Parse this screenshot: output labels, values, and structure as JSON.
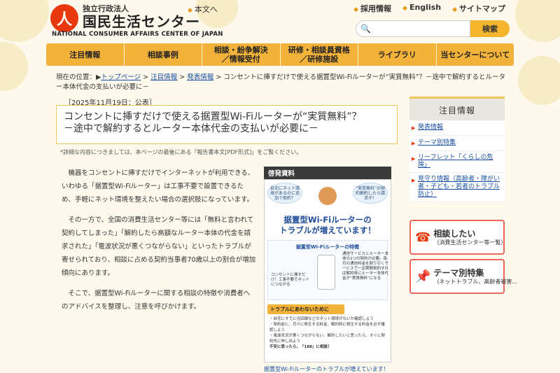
{
  "header": {
    "logo_mark": "人",
    "logo_sub": "独立行政法人",
    "logo_main": "国民生活センター",
    "logo_en": "NATIONAL CONSUMER AFFAIRS CENTER OF JAPAN",
    "body_link": "本文へ",
    "top_links": [
      "採用情報",
      "English",
      "サイトマップ"
    ],
    "search_placeholder": "",
    "search_button": "検索"
  },
  "nav": [
    "注目情報",
    "相談事例",
    "相談・紛争解決\n／情報受付",
    "研修・相談員資格\n／研修施設",
    "ライブラリ",
    "当センターについて"
  ],
  "breadcrumb": {
    "prefix": "現在の位置：",
    "links": [
      "トップページ",
      "注目情報",
      "発表情報"
    ],
    "current": "コンセントに挿すだけで使える据置型Wi-Fiルーターが“実質無料”？－途中で解約するとルーター本体代金の支払いが必要に－"
  },
  "article": {
    "date": "［2025年11月19日：公表］",
    "title_line1": "コンセントに挿すだけで使える据置型Wi-Fiルーターが“実質無料”？",
    "title_line2": "－途中で解約するとルーター本体代金の支払いが必要に－",
    "note": "*詳細な内容につきましては、本ページの最後にある「報告書本文[PDF形式]」をご覧ください。",
    "paragraphs": [
      "機器をコンセントに挿すだけでインターネットが利用できる、いわゆる「据置型Wi-Fiルーター」は工事不要で設置できるため、手軽にネット環境を整えたい場合の選択肢になっています。",
      "その一方で、全国の消費生活センター等には「無料と言われて契約してしまった」「解約したら高額なルーター本体の代金を請求された」「電波状況が悪くつながらない」といったトラブルが寄せられており、相談に占める契約当事者70歳以上の割合が増加傾向にあります。",
      "そこで、据置型Wi-Fiルーターに関する相談の特徴や消費者へのアドバイスを整理し、注意を呼びかけます。"
    ]
  },
  "poster": {
    "heading": "啓発資料",
    "bubble_left": "自宅にネット環境があるのに追加で契約？",
    "bubble_right": "“実質無料”の契約解約したら請求が！",
    "title": "据置型Wi-Fiルーターの\nトラブルが増えています！",
    "feature_title": "据置型Wi-Fiルーターの特徴",
    "feature_left": "コンセントに挿すだけ！工事不要でネットにつながる",
    "feature_right": "通信サービスとルーター本体の2つの契約が必要。毎月の通信料金を割り引くサービスで一定期間契約すれば解約時にルーター本体代金が“実質無料”になる",
    "tips_head": "トラブルにあわないために",
    "tips": [
      "・自宅にすでに光回線などのネット環境がないか確認しよう",
      "・契約前に、月々に発生する料金、解約時に発生する料金を必ず確認しよう",
      "・電波状況が悪くつながらない、解約したいと思ったら、すぐに契約先に申し出よう",
      "不安に思ったら、「188」に相談！"
    ],
    "footer": "据置型Wi-Fiルーターのトラブルが増えています！"
  },
  "sidebar": {
    "heading": "注目情報",
    "items": [
      "発表情報",
      "テーマ別特集",
      "リーフレット「くらしの危険」",
      "見守り情報（高齢者・障がい者・子ども・若者のトラブル防止）"
    ],
    "cta1_main": "相談したい",
    "cta1_sub": "（消費生活センター等一覧）",
    "cta2_main": "テーマ別特集",
    "cta2_sub": "（ネットトラブル、高齢者被害…"
  },
  "colors": {
    "accent": "#f3b33a",
    "brand_red": "#e8380d",
    "link": "#1a4fa0",
    "background": "#fdf9ec"
  }
}
